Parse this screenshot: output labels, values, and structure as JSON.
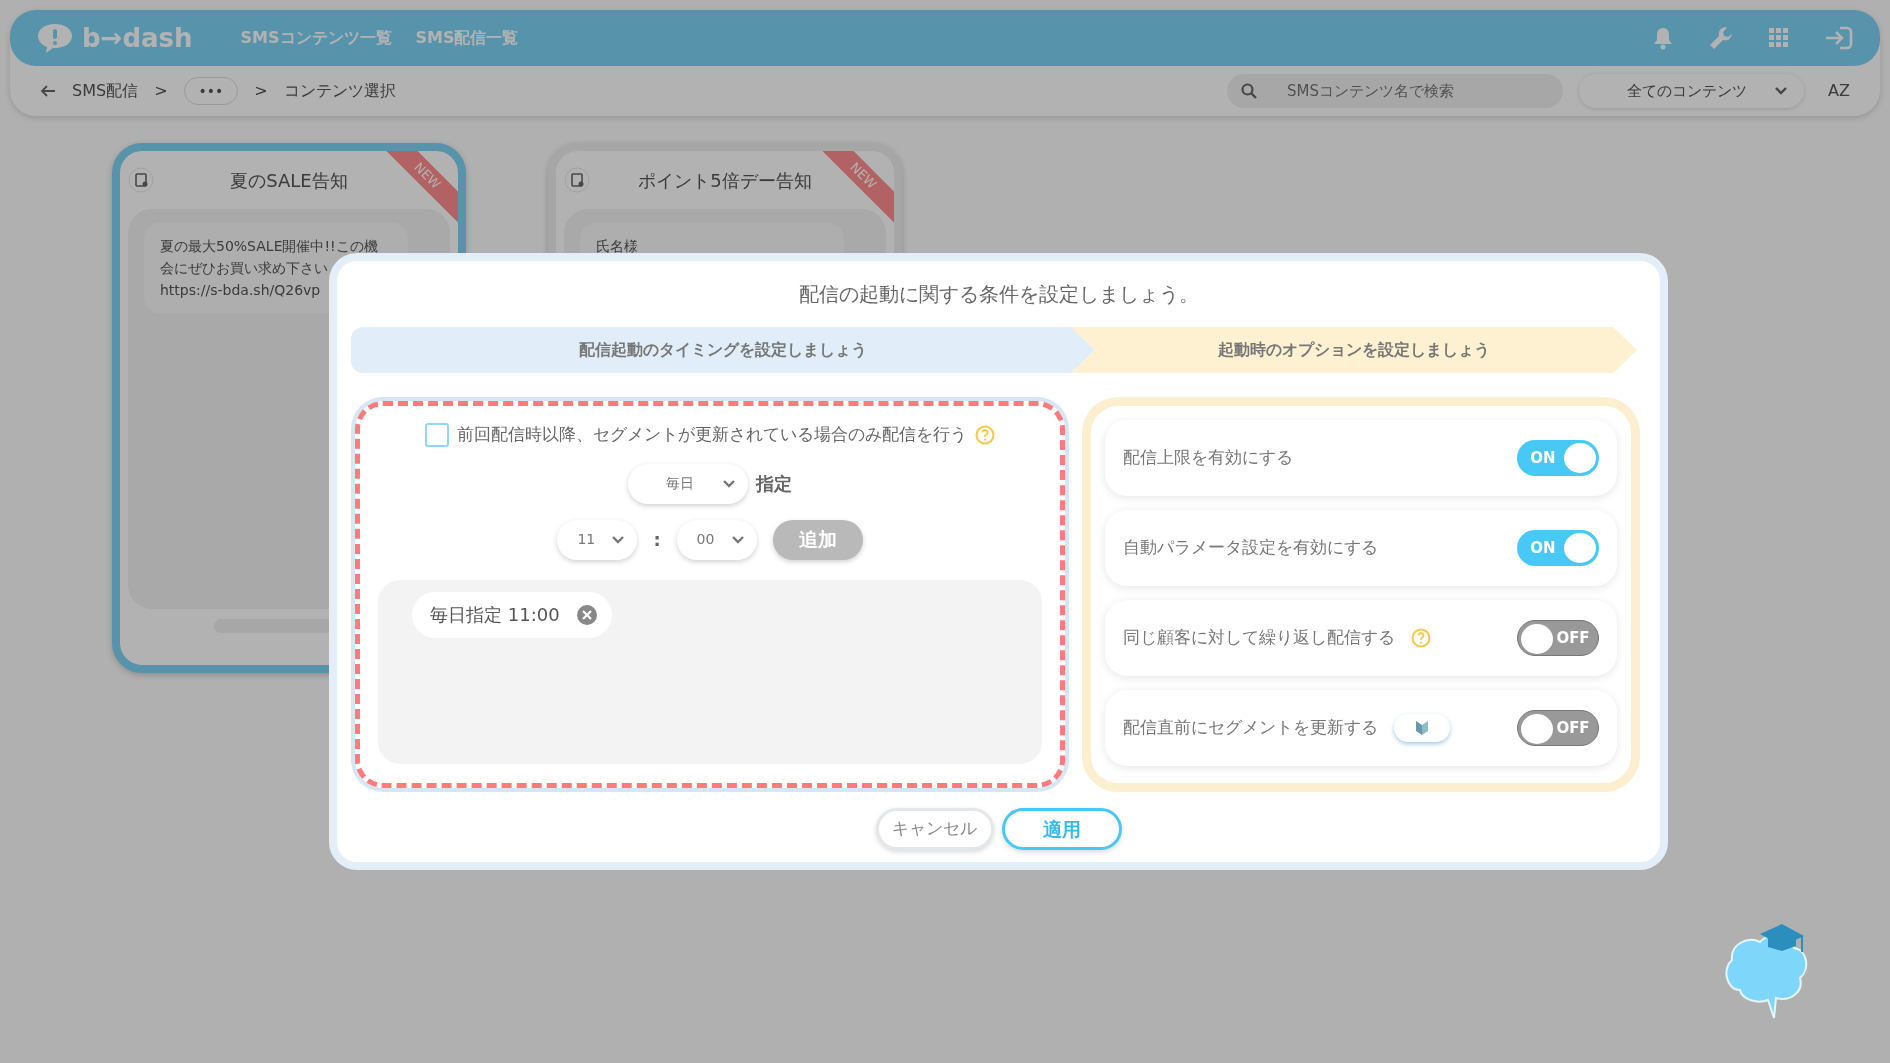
{
  "navbar": {
    "logo": "b→dash",
    "links": [
      "SMSコンテンツ一覧",
      "SMS配信一覧"
    ]
  },
  "breadcrumb": [
    {
      "kind": "link",
      "label": "SMS配信"
    },
    {
      "kind": "separator",
      "label": ">"
    },
    {
      "kind": "more",
      "label": "•••"
    },
    {
      "kind": "separator",
      "label": ">"
    },
    {
      "kind": "current",
      "label": "コンテンツ選択"
    }
  ],
  "search": {
    "placeholder": "SMSコンテンツ名で検索"
  },
  "filter": {
    "value": "全てのコンテンツ"
  },
  "sort_label": "AZ",
  "cards": [
    {
      "title": "夏のSALE告知",
      "badge": "NEW",
      "selected": true,
      "message_lines": [
        "夏の最大50%SALE開催中!!この機",
        "会にぜひお買い求め下さい",
        "https://s-bda.sh/Q26vp"
      ]
    },
    {
      "title": "ポイント5倍デー告知",
      "badge": "NEW",
      "selected": false,
      "message_lines": [
        "氏名様"
      ]
    }
  ],
  "modal": {
    "title": "配信の起動に関する条件を設定しましょう。",
    "steps": [
      {
        "label": "配信起動のタイミングを設定しましょう",
        "color": "#e1edf8"
      },
      {
        "label": "起動時のオプションを設定しましょう",
        "color": "#fdf1d2"
      }
    ],
    "timing": {
      "checkbox": {
        "label": "前回配信時以降、セグメントが更新されている場合のみ配信を行う",
        "checked": false,
        "has_help": true
      },
      "frequency": "毎日",
      "frequency_suffix": "指定",
      "hour": "11",
      "time_separator": ":",
      "minute": "00",
      "add_button": {
        "label": "追加",
        "disabled": true
      },
      "tags": [
        {
          "label": "毎日指定 11:00"
        }
      ]
    },
    "options": [
      {
        "label": "配信上限を有効にする",
        "on": true,
        "toggle_text": "ON",
        "has_help": false,
        "beginner_mark": false
      },
      {
        "label": "自動パラメータ設定を有効にする",
        "on": true,
        "toggle_text": "ON",
        "has_help": false,
        "beginner_mark": false
      },
      {
        "label": "同じ顧客に対して繰り返し配信する",
        "on": false,
        "toggle_text": "OFF",
        "has_help": true,
        "beginner_mark": false
      },
      {
        "label": "配信直前にセグメントを更新する",
        "on": false,
        "toggle_text": "OFF",
        "has_help": false,
        "beginner_mark": true
      }
    ],
    "buttons": [
      {
        "kind": "cancel",
        "label": "キャンセル"
      },
      {
        "kind": "apply",
        "label": "適用"
      }
    ]
  }
}
